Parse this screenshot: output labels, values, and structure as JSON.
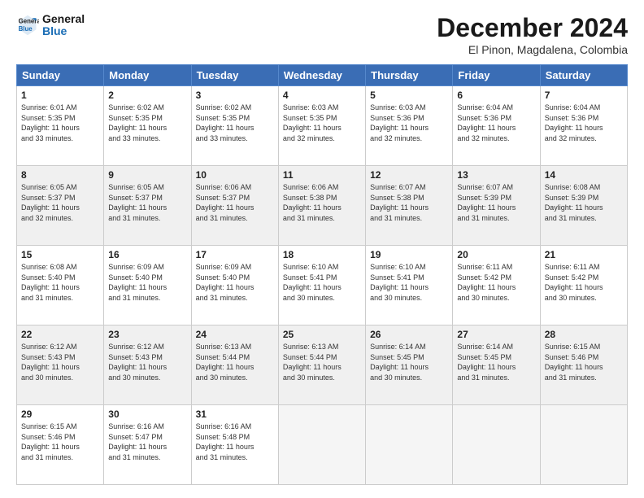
{
  "logo": {
    "line1": "General",
    "line2": "Blue"
  },
  "title": "December 2024",
  "subtitle": "El Pinon, Magdalena, Colombia",
  "headers": [
    "Sunday",
    "Monday",
    "Tuesday",
    "Wednesday",
    "Thursday",
    "Friday",
    "Saturday"
  ],
  "weeks": [
    [
      {
        "day": "1",
        "info": "Sunrise: 6:01 AM\nSunset: 5:35 PM\nDaylight: 11 hours\nand 33 minutes."
      },
      {
        "day": "2",
        "info": "Sunrise: 6:02 AM\nSunset: 5:35 PM\nDaylight: 11 hours\nand 33 minutes."
      },
      {
        "day": "3",
        "info": "Sunrise: 6:02 AM\nSunset: 5:35 PM\nDaylight: 11 hours\nand 33 minutes."
      },
      {
        "day": "4",
        "info": "Sunrise: 6:03 AM\nSunset: 5:35 PM\nDaylight: 11 hours\nand 32 minutes."
      },
      {
        "day": "5",
        "info": "Sunrise: 6:03 AM\nSunset: 5:36 PM\nDaylight: 11 hours\nand 32 minutes."
      },
      {
        "day": "6",
        "info": "Sunrise: 6:04 AM\nSunset: 5:36 PM\nDaylight: 11 hours\nand 32 minutes."
      },
      {
        "day": "7",
        "info": "Sunrise: 6:04 AM\nSunset: 5:36 PM\nDaylight: 11 hours\nand 32 minutes."
      }
    ],
    [
      {
        "day": "8",
        "info": "Sunrise: 6:05 AM\nSunset: 5:37 PM\nDaylight: 11 hours\nand 32 minutes."
      },
      {
        "day": "9",
        "info": "Sunrise: 6:05 AM\nSunset: 5:37 PM\nDaylight: 11 hours\nand 31 minutes."
      },
      {
        "day": "10",
        "info": "Sunrise: 6:06 AM\nSunset: 5:37 PM\nDaylight: 11 hours\nand 31 minutes."
      },
      {
        "day": "11",
        "info": "Sunrise: 6:06 AM\nSunset: 5:38 PM\nDaylight: 11 hours\nand 31 minutes."
      },
      {
        "day": "12",
        "info": "Sunrise: 6:07 AM\nSunset: 5:38 PM\nDaylight: 11 hours\nand 31 minutes."
      },
      {
        "day": "13",
        "info": "Sunrise: 6:07 AM\nSunset: 5:39 PM\nDaylight: 11 hours\nand 31 minutes."
      },
      {
        "day": "14",
        "info": "Sunrise: 6:08 AM\nSunset: 5:39 PM\nDaylight: 11 hours\nand 31 minutes."
      }
    ],
    [
      {
        "day": "15",
        "info": "Sunrise: 6:08 AM\nSunset: 5:40 PM\nDaylight: 11 hours\nand 31 minutes."
      },
      {
        "day": "16",
        "info": "Sunrise: 6:09 AM\nSunset: 5:40 PM\nDaylight: 11 hours\nand 31 minutes."
      },
      {
        "day": "17",
        "info": "Sunrise: 6:09 AM\nSunset: 5:40 PM\nDaylight: 11 hours\nand 31 minutes."
      },
      {
        "day": "18",
        "info": "Sunrise: 6:10 AM\nSunset: 5:41 PM\nDaylight: 11 hours\nand 30 minutes."
      },
      {
        "day": "19",
        "info": "Sunrise: 6:10 AM\nSunset: 5:41 PM\nDaylight: 11 hours\nand 30 minutes."
      },
      {
        "day": "20",
        "info": "Sunrise: 6:11 AM\nSunset: 5:42 PM\nDaylight: 11 hours\nand 30 minutes."
      },
      {
        "day": "21",
        "info": "Sunrise: 6:11 AM\nSunset: 5:42 PM\nDaylight: 11 hours\nand 30 minutes."
      }
    ],
    [
      {
        "day": "22",
        "info": "Sunrise: 6:12 AM\nSunset: 5:43 PM\nDaylight: 11 hours\nand 30 minutes."
      },
      {
        "day": "23",
        "info": "Sunrise: 6:12 AM\nSunset: 5:43 PM\nDaylight: 11 hours\nand 30 minutes."
      },
      {
        "day": "24",
        "info": "Sunrise: 6:13 AM\nSunset: 5:44 PM\nDaylight: 11 hours\nand 30 minutes."
      },
      {
        "day": "25",
        "info": "Sunrise: 6:13 AM\nSunset: 5:44 PM\nDaylight: 11 hours\nand 30 minutes."
      },
      {
        "day": "26",
        "info": "Sunrise: 6:14 AM\nSunset: 5:45 PM\nDaylight: 11 hours\nand 30 minutes."
      },
      {
        "day": "27",
        "info": "Sunrise: 6:14 AM\nSunset: 5:45 PM\nDaylight: 11 hours\nand 31 minutes."
      },
      {
        "day": "28",
        "info": "Sunrise: 6:15 AM\nSunset: 5:46 PM\nDaylight: 11 hours\nand 31 minutes."
      }
    ],
    [
      {
        "day": "29",
        "info": "Sunrise: 6:15 AM\nSunset: 5:46 PM\nDaylight: 11 hours\nand 31 minutes."
      },
      {
        "day": "30",
        "info": "Sunrise: 6:16 AM\nSunset: 5:47 PM\nDaylight: 11 hours\nand 31 minutes."
      },
      {
        "day": "31",
        "info": "Sunrise: 6:16 AM\nSunset: 5:48 PM\nDaylight: 11 hours\nand 31 minutes."
      },
      {
        "day": "",
        "info": ""
      },
      {
        "day": "",
        "info": ""
      },
      {
        "day": "",
        "info": ""
      },
      {
        "day": "",
        "info": ""
      }
    ]
  ]
}
